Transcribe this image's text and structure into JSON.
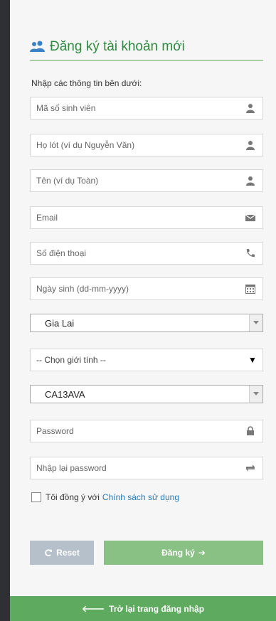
{
  "header": {
    "title": "Đăng ký tài khoản mới",
    "icon": "users-icon"
  },
  "form": {
    "intro": "Nhập các thông tin bên dưới:",
    "student_id_placeholder": "Mã số sinh viên",
    "last_name_placeholder": "Họ lót (ví dụ Nguyễn Văn)",
    "first_name_placeholder": "Tên (ví dụ Toàn)",
    "email_placeholder": "Email",
    "phone_placeholder": "Số điện thoại",
    "birthday_placeholder": "Ngày sinh (dd-mm-yyyy)",
    "province_value": "Gia Lai",
    "gender_value": "-- Chọn giới tính --",
    "class_value": "CA13AVA",
    "password_placeholder": "Password",
    "password_confirm_placeholder": "Nhập lại password",
    "agree_text": "Tôi đồng ý với",
    "agree_link": "Chính sách sử dụng"
  },
  "buttons": {
    "reset_label": "Reset",
    "register_label": "Đăng ký",
    "back_label": "Trở lại trang đăng nhập"
  },
  "colors": {
    "accent_green": "#2d8a3f",
    "register_button": "#89c184",
    "back_bar": "#5eaa5f",
    "reset_button": "#b6c0cb",
    "link_blue": "#2b79b5"
  }
}
